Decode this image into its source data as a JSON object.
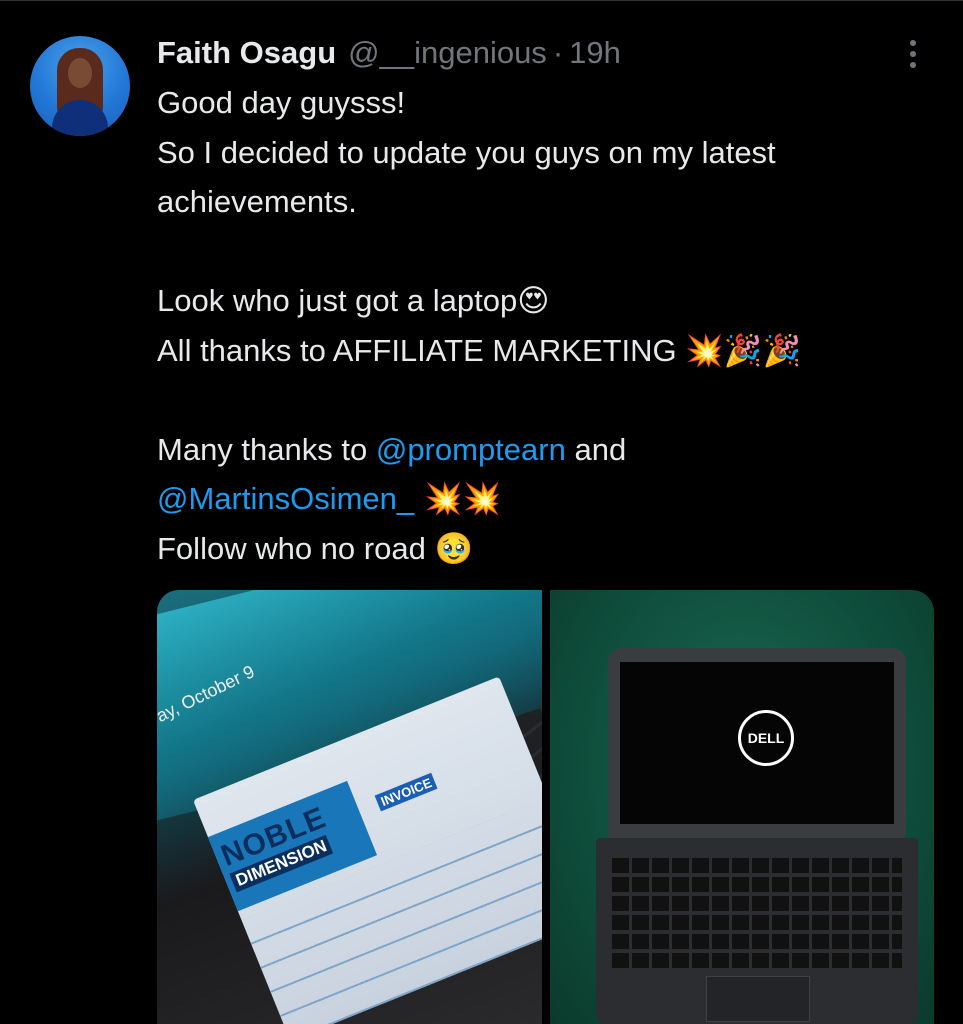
{
  "tweet": {
    "author_name": "Faith Osagu",
    "handle": "@__ingenious",
    "separator": "·",
    "time": "19h",
    "lines": {
      "l1": "Good day guysss!",
      "l2": "So I decided to update you guys on my latest",
      "l3": "achievements.",
      "l4": "Look who just got a laptop",
      "l4_emoji": "😍",
      "l5": "All thanks to AFFILIATE MARKETING ",
      "l5_emoji": "💥🎉🎉",
      "l6_pre": "Many thanks to ",
      "l6_mention": "@promptearn",
      "l6_post": " and",
      "l7_mention": "@MartinsOsimen_",
      "l7_emoji": " 💥💥",
      "l8": "Follow who no road ",
      "l8_emoji": "🥹"
    }
  },
  "media": {
    "left_photo": {
      "date_text": "ay, October 9",
      "receipt_brand": "NOBLE",
      "receipt_sub": "DIMENSION",
      "receipt_label": "INVOICE"
    },
    "right_photo": {
      "logo_text": "DELL"
    }
  },
  "icons": {
    "more": "more-vertical-icon"
  },
  "colors": {
    "background": "#000000",
    "text": "#e7e9ea",
    "secondary": "#71767b",
    "mention": "#1d9bf0"
  }
}
